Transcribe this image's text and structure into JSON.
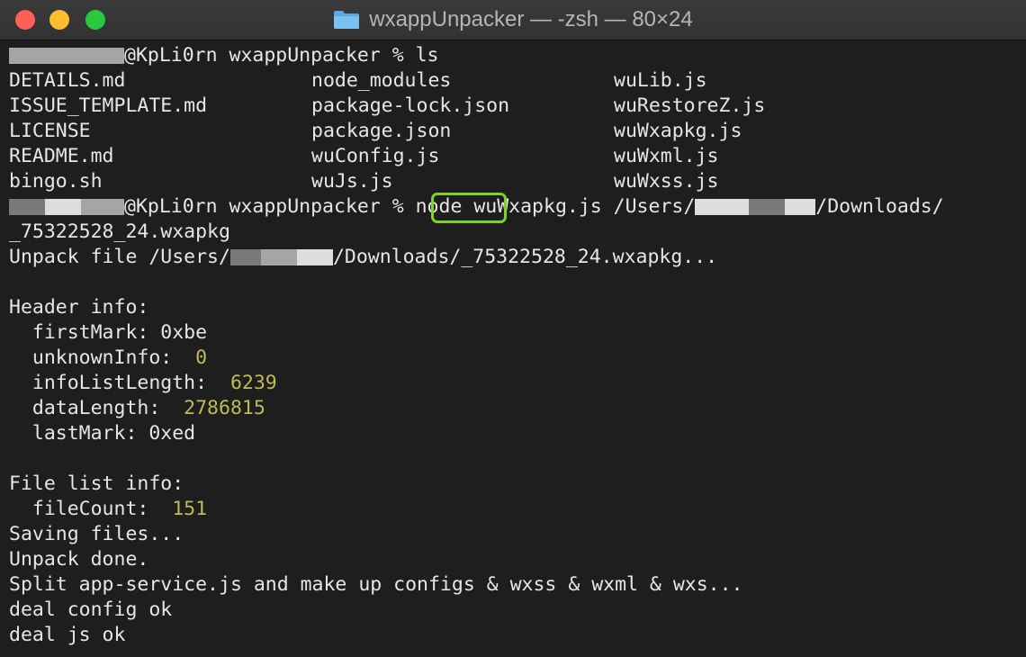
{
  "window": {
    "title": "wxappUnpacker — -zsh — 80×24"
  },
  "prompt": {
    "host_dir": "@KpLi0rn wxappUnpacker % ",
    "cmd1": "ls",
    "cmd2_node": "node",
    "cmd2_rest": " wuWxapkg.js /Users/",
    "cmd2_tail": "/Downloads/"
  },
  "ls_output": {
    "col1": [
      "DETAILS.md",
      "ISSUE_TEMPLATE.md",
      "LICENSE",
      "README.md",
      "bingo.sh"
    ],
    "col2": [
      "node_modules",
      "package-lock.json",
      "package.json",
      "wuConfig.js",
      "wuJs.js"
    ],
    "col3": [
      "wuLib.js",
      "wuRestoreZ.js",
      "wuWxapkg.js",
      "wuWxml.js",
      "wuWxss.js"
    ]
  },
  "output": {
    "wrapped": "_75322528_24.wxapkg",
    "unpack_prefix": "Unpack file /Users/",
    "unpack_suffix": "/Downloads/_75322528_24.wxapkg...",
    "header_title": "Header info:",
    "first_mark": "  firstMark: 0xbe",
    "unknown_label": "  unknownInfo:  ",
    "unknown_value": "0",
    "info_label": "  infoListLength:  ",
    "info_value": "6239",
    "data_label": "  dataLength:  ",
    "data_value": "2786815",
    "last_mark": "  lastMark: 0xed",
    "filelist_title": "File list info:",
    "filecount_label": "  fileCount:  ",
    "filecount_value": "151",
    "saving": "Saving files...",
    "done": "Unpack done.",
    "split": "Split app-service.js and make up configs & wxss & wxml & wxs...",
    "deal_config": "deal config ok",
    "deal_js": "deal js ok"
  },
  "colors": {
    "background": "#1e1e1e",
    "text": "#e6e6e6",
    "number": "#c0b956",
    "highlight": "#7ed321"
  },
  "icons": [
    "folder-icon"
  ]
}
